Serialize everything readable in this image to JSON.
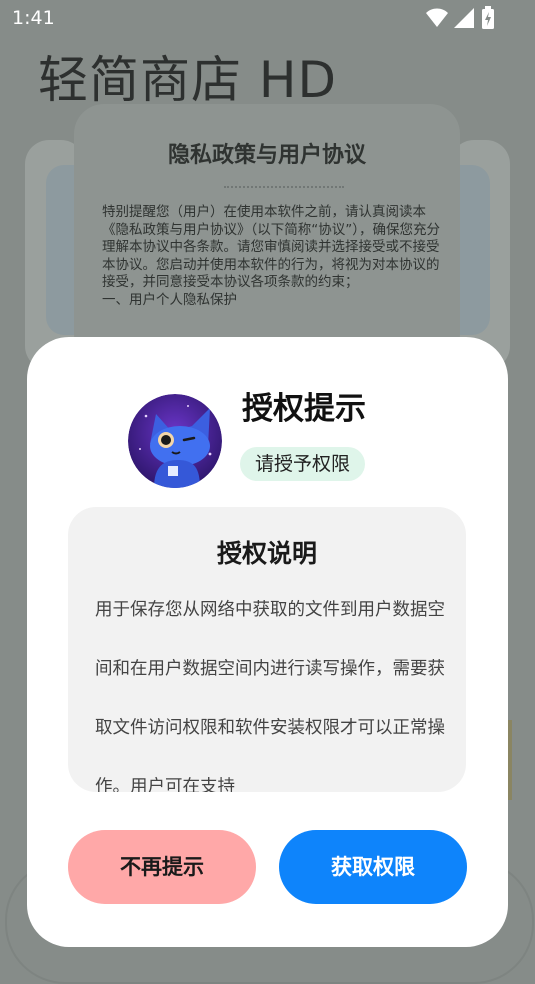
{
  "status_bar": {
    "time": "1:41",
    "icons": [
      "wifi-icon",
      "signal-icon",
      "battery-icon"
    ]
  },
  "app": {
    "title": "轻简商店 HD"
  },
  "privacy_card": {
    "title": "隐私政策与用户协议",
    "body": "特别提醒您（用户）在使用本软件之前，请认真阅读本《隐私政策与用户协议》（以下简称“协议”），确保您充分理解本协议中各条款。请您审慎阅读并选择接受或不接受本协议。您启动并使用本软件的行为，将视为对本协议的接受，并同意接受本协议各项条款的约束；\n一、用户个人隐私保护"
  },
  "dialog": {
    "title": "授权提示",
    "badge": "请授予权限",
    "desc_title": "授权说明",
    "desc_text": "用于保存您从网络中获取的文件到用户数据空间和在用户数据空间内进行读写操作，需要获取文件访问权限和软件安装权限才可以正常操作。用户可在支持",
    "deny_label": "不再提示",
    "grant_label": "获取权限"
  },
  "colors": {
    "scrim": "#868c89",
    "badge_bg": "#dff5ea",
    "deny_bg": "#ffa8a8",
    "grant_bg": "#0e84fb"
  }
}
